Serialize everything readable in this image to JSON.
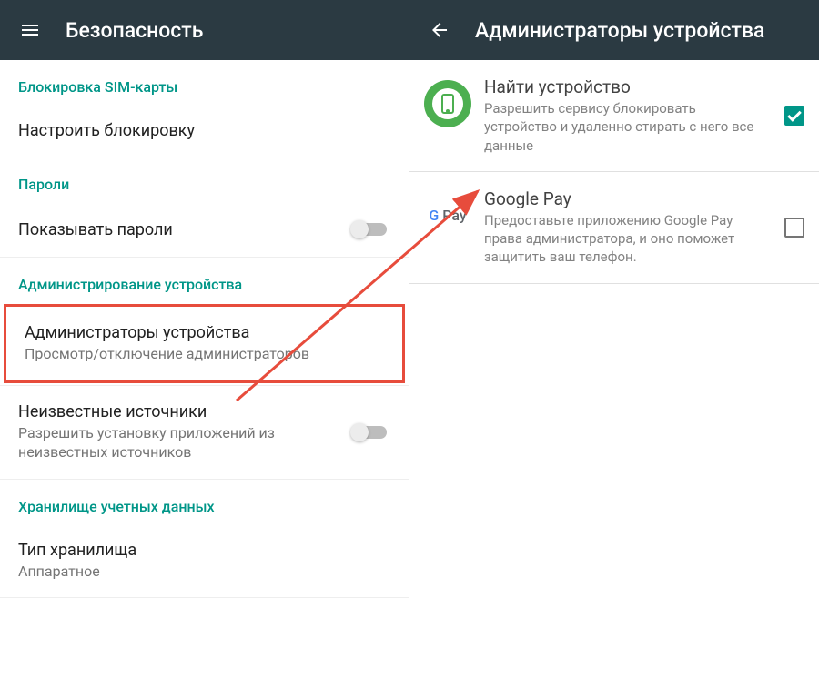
{
  "left": {
    "appbar_title": "Безопасность",
    "sections": {
      "sim_lock_header": "Блокировка SIM-карты",
      "configure_lock": "Настроить блокировку",
      "passwords_header": "Пароли",
      "show_passwords": "Показывать пароли",
      "device_admin_header": "Администрирование устройства",
      "device_admins_title": "Администраторы устройства",
      "device_admins_subtitle": "Просмотр/отключение администраторов",
      "unknown_sources_title": "Неизвестные источники",
      "unknown_sources_subtitle": "Разрешить установку приложений из неизвестных источников",
      "credentials_header": "Хранилище учетных данных",
      "storage_type_title": "Тип хранилища",
      "storage_type_subtitle": "Аппаратное"
    }
  },
  "right": {
    "appbar_title": "Администраторы устройства",
    "items": {
      "find_device": {
        "title": "Найти устройство",
        "desc": "Разрешить сервису блокировать устройство и удаленно стирать с него все данные",
        "checked": true
      },
      "google_pay": {
        "title": "Google Pay",
        "desc": "Предоставьте приложению Google Pay права администратора, и оно поможет защитить ваш телефон.",
        "checked": false
      }
    }
  }
}
